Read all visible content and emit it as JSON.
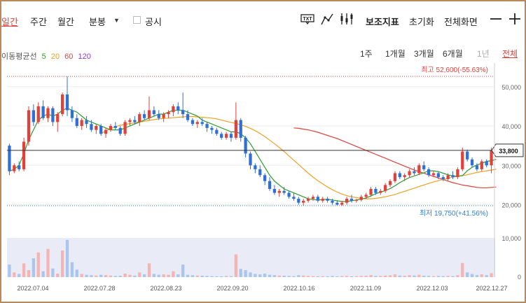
{
  "toolbar": {
    "tabs": [
      "일간",
      "주간",
      "월간",
      "분봉"
    ],
    "active_tab": "일간",
    "notice_label": "공시",
    "aux_indicator": "보조지표",
    "reset": "초기화",
    "fullscreen": "전체화면",
    "icons": [
      "txt-icon",
      "drawing-icon",
      "candle-settings-icon",
      "minus-icon",
      "plus-icon"
    ]
  },
  "indicator_bar": {
    "label": "이동평균선",
    "periods": [
      {
        "label": "5",
        "color": "#2e9b2e"
      },
      {
        "label": "20",
        "color": "#f0a020"
      },
      {
        "label": "60",
        "color": "#e0413a"
      },
      {
        "label": "120",
        "color": "#8a3fd1"
      }
    ]
  },
  "range_buttons": [
    "1주",
    "1개월",
    "3개월",
    "6개월",
    "1년",
    "전체"
  ],
  "active_range": "전체",
  "chart_data": {
    "type": "candlestick",
    "x_tick_labels": [
      "2022.07.04",
      "2022.07.28",
      "2022.08.23",
      "2022.09.20",
      "2022.10.16",
      "2022.11.09",
      "2022.12.03",
      "2022.12.27"
    ],
    "y_tick_labels": [
      "50,000",
      "40,000",
      "30,000",
      "20,000"
    ],
    "ylim": [
      16000,
      56000
    ],
    "volume_tick_labels": [
      "10,000",
      "0"
    ],
    "volume_ylim": [
      0,
      10000
    ],
    "annotations": {
      "high": {
        "label": "최고 52,600(-55.63%)",
        "value": 52600,
        "color": "#e0413a"
      },
      "low": {
        "label": "최저 19,750(+41.56%)",
        "value": 19750,
        "color": "#2f7fd0"
      },
      "current": {
        "label": "33,800",
        "value": 33800
      }
    },
    "up_color": "#e0413a",
    "down_color": "#2f6fd6",
    "ma_colors": {
      "ma5": "#2e9b2e",
      "ma20": "#f0a020",
      "ma60": "#e0413a"
    },
    "ohlc": [
      [
        35000,
        35500,
        27500,
        28500
      ],
      [
        28500,
        30500,
        28000,
        30000
      ],
      [
        30000,
        31000,
        28500,
        29000
      ],
      [
        29000,
        37000,
        28500,
        36000
      ],
      [
        36000,
        45000,
        35000,
        44000
      ],
      [
        44000,
        45500,
        40000,
        41000
      ],
      [
        41000,
        46000,
        40500,
        45000
      ],
      [
        45000,
        46500,
        41500,
        42000
      ],
      [
        42000,
        45000,
        41000,
        44500
      ],
      [
        44500,
        45000,
        40000,
        41000
      ],
      [
        41000,
        43500,
        38500,
        43000
      ],
      [
        43000,
        48500,
        42500,
        48000
      ],
      [
        48000,
        52600,
        42500,
        44000
      ],
      [
        44000,
        45000,
        41000,
        42000
      ],
      [
        42000,
        43000,
        39500,
        40000
      ],
      [
        40000,
        42000,
        39000,
        41500
      ],
      [
        41500,
        42500,
        39500,
        40500
      ],
      [
        40500,
        41500,
        38500,
        39000
      ],
      [
        39000,
        40500,
        38000,
        40000
      ],
      [
        40000,
        40500,
        37500,
        38000
      ],
      [
        38000,
        39500,
        37000,
        39000
      ],
      [
        39000,
        40500,
        38500,
        40000
      ],
      [
        40000,
        41000,
        39000,
        39500
      ],
      [
        39500,
        40000,
        37500,
        38000
      ],
      [
        38000,
        41500,
        37500,
        41000
      ],
      [
        41000,
        42000,
        40000,
        41500
      ],
      [
        41500,
        42500,
        40500,
        41000
      ],
      [
        41000,
        43500,
        40000,
        43000
      ],
      [
        43000,
        44000,
        41500,
        42000
      ],
      [
        42000,
        47500,
        41500,
        44000
      ],
      [
        44000,
        45000,
        42500,
        43000
      ],
      [
        43000,
        44000,
        41500,
        42000
      ],
      [
        42000,
        43500,
        41000,
        43000
      ],
      [
        43000,
        44000,
        42000,
        43500
      ],
      [
        43500,
        45500,
        42500,
        45000
      ],
      [
        45000,
        46000,
        43000,
        44000
      ],
      [
        44000,
        48500,
        42000,
        43000
      ],
      [
        43000,
        44000,
        41000,
        41500
      ],
      [
        41500,
        42000,
        40000,
        40500
      ],
      [
        40500,
        41500,
        39500,
        41000
      ],
      [
        41000,
        42000,
        40000,
        40500
      ],
      [
        40500,
        41000,
        38500,
        39500
      ],
      [
        39500,
        40000,
        38000,
        39000
      ],
      [
        39000,
        39500,
        37500,
        38000
      ],
      [
        38000,
        38500,
        36500,
        37000
      ],
      [
        37000,
        38500,
        36500,
        38000
      ],
      [
        38000,
        38500,
        36000,
        37000
      ],
      [
        37000,
        46000,
        36500,
        41500
      ],
      [
        41500,
        42000,
        36000,
        37000
      ],
      [
        37000,
        37500,
        32000,
        33000
      ],
      [
        33000,
        33500,
        29000,
        30000
      ],
      [
        30000,
        30500,
        28000,
        29000
      ],
      [
        29000,
        30000,
        27000,
        27500
      ],
      [
        27500,
        28000,
        25000,
        26000
      ],
      [
        26000,
        27000,
        23500,
        24000
      ],
      [
        24000,
        25000,
        22500,
        23000
      ],
      [
        23000,
        24000,
        22000,
        23500
      ],
      [
        23500,
        24500,
        22500,
        23000
      ],
      [
        23000,
        23500,
        21500,
        22000
      ],
      [
        22000,
        23000,
        21000,
        21500
      ],
      [
        21500,
        22000,
        20000,
        20500
      ],
      [
        20500,
        21500,
        19750,
        21000
      ],
      [
        21000,
        22000,
        20500,
        21500
      ],
      [
        21500,
        22500,
        21000,
        22000
      ],
      [
        22000,
        22500,
        20500,
        21000
      ],
      [
        21000,
        22000,
        20500,
        21500
      ],
      [
        21500,
        22000,
        20500,
        21000
      ],
      [
        21000,
        21500,
        20000,
        20500
      ],
      [
        20500,
        21000,
        19750,
        20000
      ],
      [
        20000,
        21000,
        19750,
        20500
      ],
      [
        20500,
        22000,
        20000,
        21500
      ],
      [
        21500,
        22500,
        20500,
        21000
      ],
      [
        21000,
        21500,
        20500,
        21200
      ],
      [
        21200,
        22500,
        20800,
        22000
      ],
      [
        22000,
        23000,
        21500,
        22500
      ],
      [
        22500,
        24500,
        22000,
        24000
      ],
      [
        24000,
        24500,
        22500,
        23000
      ],
      [
        23000,
        24000,
        22500,
        23500
      ],
      [
        23500,
        25500,
        23000,
        25000
      ],
      [
        25000,
        26500,
        24500,
        26000
      ],
      [
        26000,
        28500,
        25500,
        28000
      ],
      [
        28000,
        28500,
        26500,
        27000
      ],
      [
        27000,
        28000,
        26000,
        27500
      ],
      [
        27500,
        29000,
        27000,
        28500
      ],
      [
        28500,
        29500,
        27500,
        28000
      ],
      [
        28000,
        30500,
        27500,
        30000
      ],
      [
        30000,
        31000,
        28500,
        29000
      ],
      [
        29000,
        29500,
        27000,
        27500
      ],
      [
        27500,
        28500,
        27000,
        28000
      ],
      [
        28000,
        28500,
        26500,
        27000
      ],
      [
        27000,
        27500,
        26000,
        26500
      ],
      [
        26500,
        28000,
        26000,
        27500
      ],
      [
        27500,
        28500,
        26500,
        27000
      ],
      [
        27000,
        29500,
        26500,
        29000
      ],
      [
        29000,
        34500,
        28500,
        33500
      ],
      [
        33500,
        34000,
        31000,
        31500
      ],
      [
        31500,
        32000,
        29500,
        30000
      ],
      [
        30000,
        30500,
        28500,
        29000
      ],
      [
        29000,
        31500,
        28500,
        31000
      ],
      [
        31000,
        31500,
        29500,
        30000
      ],
      [
        30000,
        34500,
        28000,
        33800
      ]
    ],
    "ma5": [
      28500,
      29000,
      30000,
      33000,
      36500,
      39000,
      41500,
      42500,
      43000,
      42500,
      43000,
      44000,
      44500,
      44000,
      43500,
      42500,
      41500,
      41000,
      40500,
      40000,
      39500,
      39000,
      39000,
      39000,
      39500,
      40000,
      40500,
      41000,
      41500,
      42000,
      42500,
      43000,
      43000,
      43500,
      44000,
      44000,
      44000,
      43500,
      43000,
      42500,
      41500,
      41000,
      40500,
      40000,
      39500,
      39000,
      38500,
      38500,
      38000,
      37000,
      35500,
      33500,
      31500,
      29500,
      27500,
      26000,
      25000,
      24000,
      23500,
      23000,
      22500,
      22000,
      21500,
      21300,
      21200,
      21300,
      21400,
      21200,
      21000,
      20800,
      20800,
      21000,
      21200,
      21400,
      21700,
      22200,
      22800,
      23200,
      23600,
      24100,
      24800,
      25600,
      26300,
      26900,
      27300,
      27700,
      28100,
      28600,
      28600,
      28400,
      28000,
      27600,
      27300,
      27200,
      27400,
      28600,
      29500,
      30100,
      30500,
      31000,
      31200,
      31500
    ],
    "ma20": [
      null,
      null,
      null,
      null,
      null,
      null,
      null,
      null,
      null,
      null,
      null,
      null,
      null,
      null,
      null,
      null,
      null,
      null,
      null,
      38000,
      38800,
      39300,
      39800,
      40200,
      40400,
      40600,
      40800,
      41000,
      41200,
      41400,
      41600,
      41800,
      41900,
      42000,
      42100,
      42200,
      42300,
      42400,
      42400,
      42300,
      42200,
      42100,
      42000,
      41800,
      41500,
      41200,
      40900,
      40600,
      40300,
      39900,
      39400,
      38800,
      38100,
      37300,
      36400,
      35500,
      34500,
      33500,
      32400,
      31300,
      30200,
      29100,
      28000,
      27000,
      26100,
      25300,
      24500,
      23800,
      23200,
      22700,
      22300,
      22000,
      21800,
      21600,
      21500,
      21500,
      21600,
      21800,
      22000,
      22300,
      22600,
      23000,
      23400,
      23800,
      24200,
      24600,
      25000,
      25400,
      25800,
      26100,
      26400,
      26700,
      27000,
      27200,
      27400,
      27600,
      27900,
      28200,
      28400,
      28600,
      28800,
      29000
    ],
    "ma60": [
      null,
      null,
      null,
      null,
      null,
      null,
      null,
      null,
      null,
      null,
      null,
      null,
      null,
      null,
      null,
      null,
      null,
      null,
      null,
      null,
      null,
      null,
      null,
      null,
      null,
      null,
      null,
      null,
      null,
      null,
      null,
      null,
      null,
      null,
      null,
      null,
      null,
      null,
      null,
      null,
      null,
      null,
      null,
      null,
      null,
      null,
      null,
      null,
      null,
      null,
      null,
      null,
      null,
      null,
      null,
      null,
      null,
      null,
      null,
      39500,
      39400,
      39200,
      39000,
      38700,
      38400,
      38000,
      37600,
      37200,
      36800,
      36300,
      35800,
      35300,
      34800,
      34300,
      33800,
      33300,
      32800,
      32300,
      31800,
      31300,
      30800,
      30300,
      29800,
      29300,
      28800,
      28400,
      28000,
      27600,
      27200,
      26800,
      26400,
      26000,
      25600,
      25300,
      25000,
      24800,
      24600,
      24400,
      24300,
      24300,
      24400,
      24500
    ]
  },
  "volume": [
    3200,
    1200,
    800,
    3500,
    1800,
    4800,
    6300,
    1500,
    7200,
    2200,
    900,
    6800,
    9500,
    3800,
    1900,
    800,
    600,
    500,
    400,
    600,
    500,
    400,
    300,
    350,
    900,
    600,
    400,
    1200,
    700,
    3500,
    800,
    600,
    700,
    600,
    1500,
    700,
    3200,
    600,
    500,
    400,
    350,
    300,
    250,
    200,
    200,
    300,
    250,
    5800,
    2100,
    1800,
    1200,
    800,
    700,
    900,
    600,
    500,
    400,
    350,
    300,
    250,
    500,
    400,
    300,
    250,
    200,
    250,
    200,
    300,
    200,
    250,
    300,
    200,
    250,
    300,
    350,
    500,
    300,
    300,
    400,
    450,
    700,
    400,
    350,
    500,
    400,
    600,
    350,
    300,
    250,
    300,
    250,
    300,
    250,
    500,
    3600,
    1200,
    800,
    500,
    700,
    500,
    1000
  ]
}
